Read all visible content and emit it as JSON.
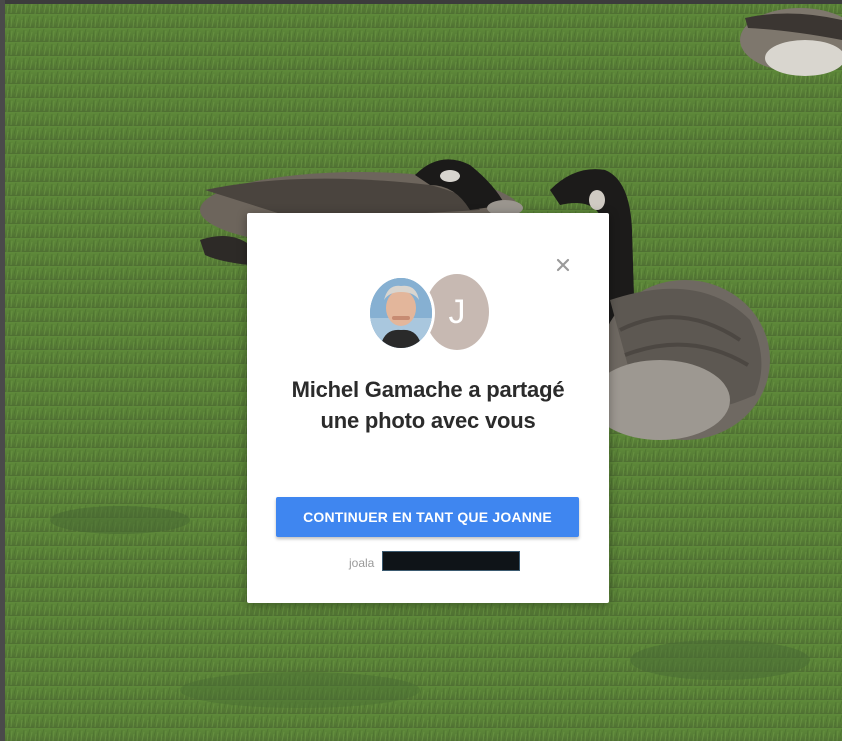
{
  "background": {
    "image": "goose-grass-photo",
    "grass_color": "#5b7a3c"
  },
  "modal": {
    "close_icon": "close-icon",
    "avatars": {
      "sharer_photo": "sharer-avatar-photo",
      "user_initial": "J",
      "user_avatar_color": "#c7b9b2"
    },
    "title": "Michel Gamache a partagé une photo avec vous",
    "continue_button_label": "CONTINUER EN TANT QUE JOANNE",
    "continue_button_color": "#3f86f0",
    "account_email_visible": "joala"
  }
}
